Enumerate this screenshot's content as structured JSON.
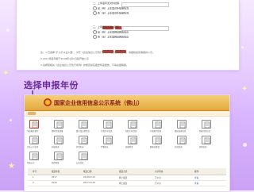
{
  "caption": {
    "step_text": "选择申报年份"
  },
  "top_panel": {
    "options": [
      "二、上年度有无对外担保",
      "是（有）上年度对外担保情况",
      "否（无）上年度对外担保情况",
      "三、上年度有无网站网店",
      "是（有）上年度网站网店信息",
      "否（无）上年度网站网店信息"
    ],
    "notes": [
      "注：1.已选择“不公示从业人数”，对于《企业信息公示暂行条例》规定的其他事项，请继续如实填报并公示。",
      "2.2017年度年报于2018年1月1日起开始公示",
      "3.请按照相关《企业信息公示暂行条例》的规定如实报送年度报告，不得虚报瞒报。"
    ]
  },
  "site": {
    "title": "国家企业信用信息公示系统（佛山）",
    "tiles": [
      "年度报告填写",
      "即时信息填报",
      "股东及出资信息",
      "行政许可信息",
      "知识产权信息",
      "行政处罚信息",
      "股权变更信息",
      "简易注销公告",
      "企业公示信息",
      "年报修改",
      "异常名录",
      "严重违法",
      "抽查检查",
      "联络员备案",
      "信息查询",
      "其他信息",
      "年报公示",
      "信用修复",
      "公告信息"
    ],
    "table": {
      "headers": [
        "序号",
        "报送年度",
        "报送日期",
        "报送方式",
        "公示状态",
        "操作"
      ],
      "rows": [
        [
          "1",
          "2017",
          "2018-03-12",
          "网上报送",
          "已公示",
          "查看"
        ],
        [
          "2",
          "2016",
          "2017-04-20",
          "网上报送",
          "已公示",
          "查看"
        ]
      ]
    }
  },
  "colors": {
    "accent": "#c0392b",
    "brand_gold": "#e4a83c",
    "caption": "#6a2a9a",
    "background": "#d9b6ff"
  }
}
